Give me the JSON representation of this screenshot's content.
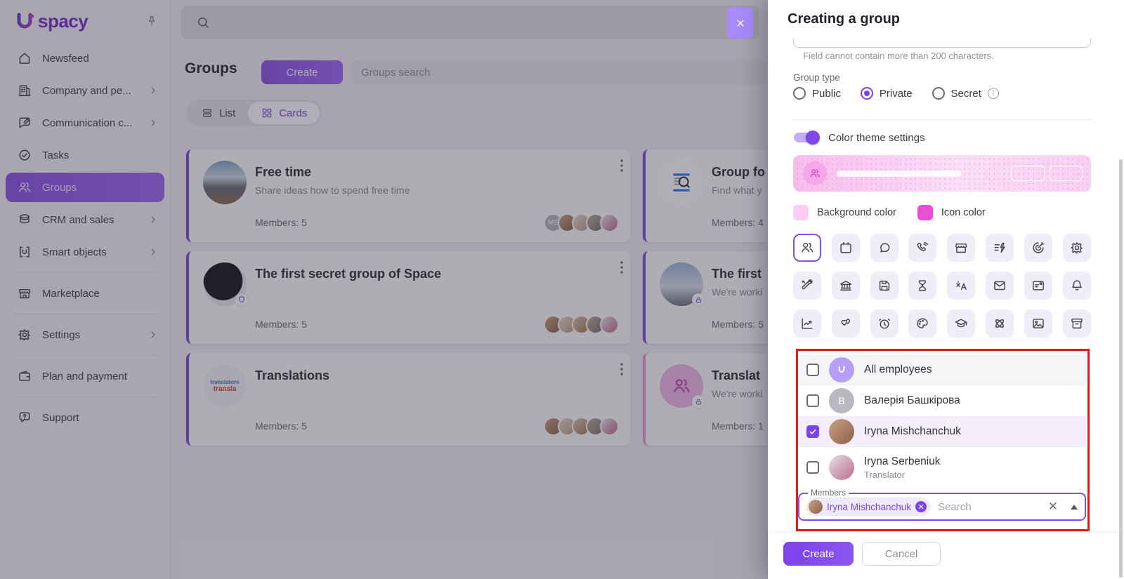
{
  "app": {
    "logo_prefix": "U",
    "logo_suffix": "spacy"
  },
  "sidebar": {
    "items": [
      {
        "label": "Newsfeed"
      },
      {
        "label": "Company and pe..."
      },
      {
        "label": "Communication c..."
      },
      {
        "label": "Tasks"
      },
      {
        "label": "Groups",
        "active": true
      },
      {
        "label": "CRM and sales"
      },
      {
        "label": "Smart objects"
      },
      {
        "label": "Marketplace"
      },
      {
        "label": "Settings"
      },
      {
        "label": "Plan and payment"
      },
      {
        "label": "Support"
      }
    ]
  },
  "groups_page": {
    "title": "Groups",
    "create_button": "Create",
    "search_placeholder": "Groups search",
    "view_list": "List",
    "view_cards": "Cards",
    "cards": [
      {
        "title": "Free time",
        "subtitle": "Share ideas how to spend free time",
        "members": "Members: 5",
        "avatar_initials": "MS"
      },
      {
        "title": "The first secret group of Space",
        "subtitle": "",
        "members": "Members: 5"
      },
      {
        "title": "Translations",
        "subtitle": "",
        "members": "Members: 5"
      },
      {
        "title": "Group fo",
        "subtitle": "Find what y",
        "members": "Members: 4"
      },
      {
        "title": "The first",
        "subtitle": "We're worki",
        "members": "Members: 5"
      },
      {
        "title": "Translat",
        "subtitle": "We're worki",
        "members": "Members: 1"
      }
    ],
    "word_cloud_avatar": {
      "line1": "translators",
      "line2": "transla"
    }
  },
  "modal": {
    "title": "Creating a group",
    "helper_text": "Field cannot contain more than 200 characters.",
    "group_type_label": "Group type",
    "group_types": [
      {
        "label": "Public",
        "selected": false
      },
      {
        "label": "Private",
        "selected": true
      },
      {
        "label": "Secret",
        "selected": false,
        "has_info_icon": true
      }
    ],
    "color_theme_label": "Color theme settings",
    "color_theme_enabled": true,
    "colors": {
      "background_label": "Background color",
      "background_value": "#fbcdf5",
      "icon_label": "Icon color",
      "icon_value": "#e94fd2"
    },
    "icon_options": [
      "people",
      "calendar",
      "chat",
      "phone",
      "store",
      "list-lightning",
      "target",
      "gear",
      "tools",
      "bank",
      "save",
      "hourglass",
      "translate",
      "mail",
      "contact-card",
      "bell",
      "chart",
      "hearts",
      "alarm-clock",
      "palette",
      "graduation-cap",
      "atom",
      "image",
      "archive"
    ],
    "selected_icon": "people",
    "members_list": [
      {
        "name": "All employees",
        "checked": false
      },
      {
        "name": "Валерія Башкірова",
        "initial": "B",
        "checked": false
      },
      {
        "name": "Iryna Mishchanchuk",
        "checked": true
      },
      {
        "name": "Iryna Serbeniuk",
        "subtitle": "Translator",
        "checked": false
      }
    ],
    "members_field": {
      "label": "Members",
      "chip": "Iryna Mishchanchuk",
      "placeholder": "Search"
    },
    "footer": {
      "create": "Create",
      "cancel": "Cancel"
    },
    "accent_color": "#8150ea",
    "annotation_color": "#e51c15"
  }
}
